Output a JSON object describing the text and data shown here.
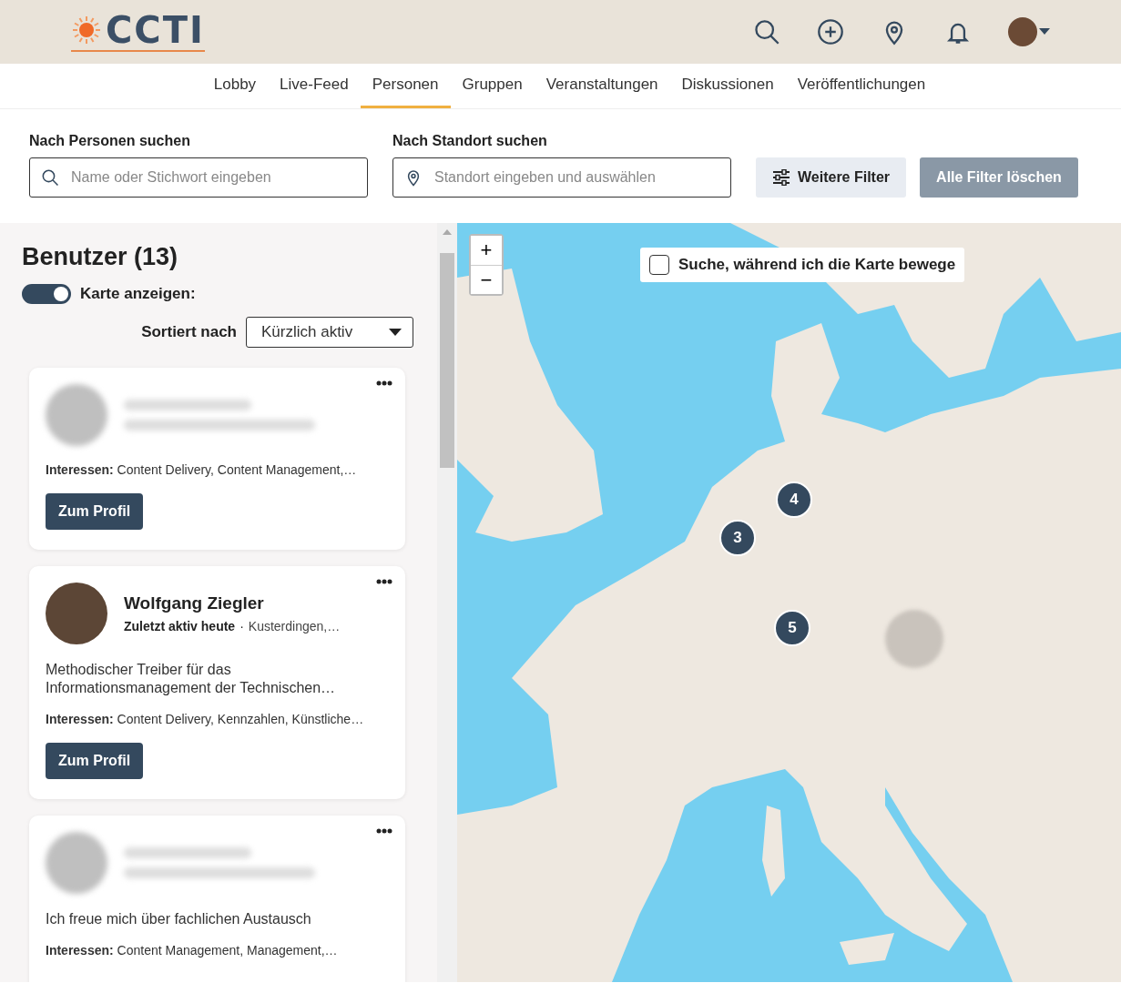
{
  "header": {
    "logo": "CCTI"
  },
  "nav": [
    {
      "label": "Lobby",
      "selected": false
    },
    {
      "label": "Live-Feed",
      "selected": false
    },
    {
      "label": "Personen",
      "selected": true
    },
    {
      "label": "Gruppen",
      "selected": false
    },
    {
      "label": "Veranstaltungen",
      "selected": false
    },
    {
      "label": "Diskussionen",
      "selected": false
    },
    {
      "label": "Veröffentlichungen",
      "selected": false
    }
  ],
  "filters": {
    "person_label": "Nach Personen suchen",
    "person_placeholder": "Name oder Stichwort eingeben",
    "location_label": "Nach Standort suchen",
    "location_placeholder": "Standort eingeben und auswählen",
    "more_filters": "Weitere Filter",
    "clear_filters": "Alle Filter löschen"
  },
  "results": {
    "title": "Benutzer (13)",
    "map_toggle": {
      "label": "Karte anzeigen:",
      "on": true
    },
    "sort_label": "Sortiert nach",
    "sort_value": "Kürzlich aktiv"
  },
  "cards": [
    {
      "blurred": true,
      "interests": "**Interessen:** Content Delivery, Content Management,…",
      "button": "Zum Profil"
    },
    {
      "blurred": false,
      "name": "Wolfgang Ziegler",
      "status": "Zuletzt aktiv heute",
      "separator": "·",
      "location": "Kusterdingen,…",
      "bio": "Methodischer Treiber für das Informationsmanagement der Technischen…",
      "interests": "**Interessen:** Content Delivery, Kennzahlen, Künstliche…",
      "button": "Zum Profil"
    },
    {
      "blurred": true,
      "bio": "Ich freue mich über fachlichen Austausch",
      "interests": "**Interessen:** Content Management, Management,…"
    }
  ],
  "map": {
    "zoom_in": "+",
    "zoom_out": "−",
    "search_on_move": {
      "label": "Suche, während ich die Karte bewege",
      "checked": false
    },
    "markers": [
      {
        "kind": "cluster",
        "count": "4"
      },
      {
        "kind": "cluster",
        "count": "3"
      },
      {
        "kind": "cluster",
        "count": "5"
      },
      {
        "kind": "photo"
      }
    ]
  }
}
